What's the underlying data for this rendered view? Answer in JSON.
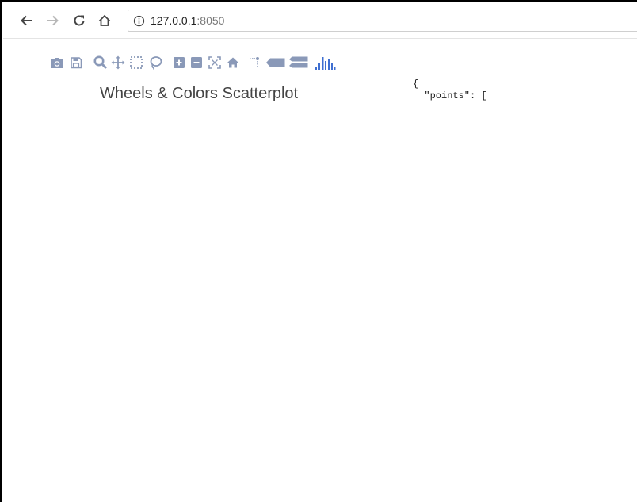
{
  "browser": {
    "url_host": "127.0.0.1",
    "url_port": ":8050"
  },
  "modebar": {
    "icons": [
      "camera-icon",
      "save-icon",
      "zoom-icon",
      "pan-icon",
      "box-select-icon",
      "lasso-select-icon",
      "zoom-in-icon",
      "zoom-out-icon",
      "autoscale-icon",
      "reset-axes-icon",
      "toggle-spike-lines-icon",
      "hover-closest-icon",
      "hover-compare-icon",
      "plotly-logo-icon"
    ],
    "color": "#8a99b8",
    "logo_color": "#3f6fd1"
  },
  "graph": {
    "title": "Wheels & Colors Scatterplot"
  },
  "json_output": {
    "line1": "{",
    "line2": "  \"points\": ["
  }
}
